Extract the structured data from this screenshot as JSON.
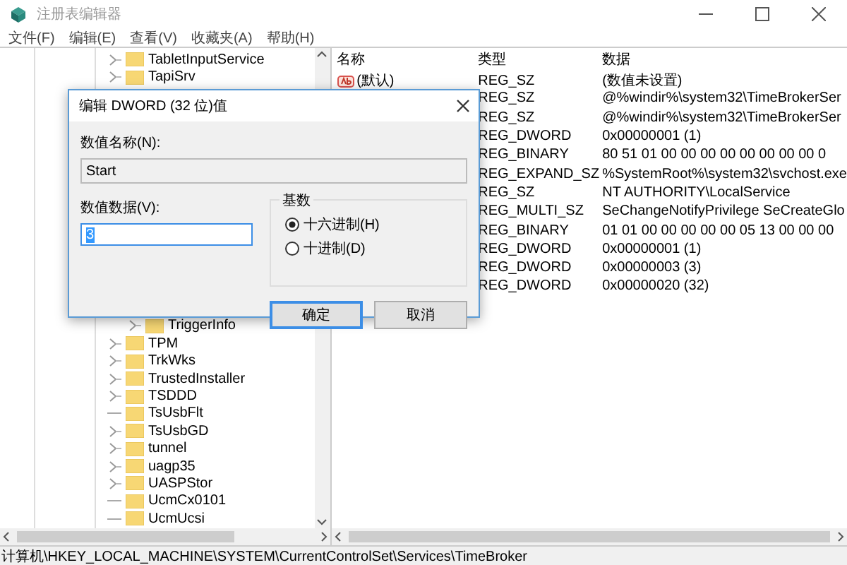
{
  "window": {
    "title": "注册表编辑器"
  },
  "menu": [
    "文件(F)",
    "编辑(E)",
    "查看(V)",
    "收藏夹(A)",
    "帮助(H)"
  ],
  "tree": {
    "items": [
      {
        "label": "TabletInputService",
        "expandable": true
      },
      {
        "label": "TapiSrv",
        "expandable": true
      },
      {
        "children": [
          {
            "label": "TriggerInfo",
            "expandable": true
          }
        ]
      },
      {
        "label": "TPM",
        "expandable": true
      },
      {
        "label": "TrkWks",
        "expandable": true
      },
      {
        "label": "TrustedInstaller",
        "expandable": true
      },
      {
        "label": "TSDDD",
        "expandable": true
      },
      {
        "label": "TsUsbFlt",
        "expandable": false
      },
      {
        "label": "TsUsbGD",
        "expandable": true
      },
      {
        "label": "tunnel",
        "expandable": true
      },
      {
        "label": "uagp35",
        "expandable": true
      },
      {
        "label": "UASPStor",
        "expandable": true
      },
      {
        "label": "UcmCx0101",
        "expandable": false
      },
      {
        "label": "UcmUcsi",
        "expandable": false
      }
    ]
  },
  "values": {
    "columns": [
      "名称",
      "类型",
      "数据"
    ],
    "rows": [
      {
        "name": "(默认)",
        "type": "REG_SZ",
        "data": "(数值未设置)"
      },
      {
        "type": "REG_SZ",
        "data": "@%windir%\\system32\\TimeBrokerSer"
      },
      {
        "type": "REG_SZ",
        "data": "@%windir%\\system32\\TimeBrokerSer"
      },
      {
        "type": "REG_DWORD",
        "data": "0x00000001 (1)"
      },
      {
        "type": "REG_BINARY",
        "data": "80 51 01 00 00 00 00 00 00 00 00 0"
      },
      {
        "type": "REG_EXPAND_SZ",
        "data": "%SystemRoot%\\system32\\svchost.exe"
      },
      {
        "type": "REG_SZ",
        "data": "NT AUTHORITY\\LocalService"
      },
      {
        "type": "REG_MULTI_SZ",
        "data": "SeChangeNotifyPrivilege SeCreateGlo"
      },
      {
        "type": "REG_BINARY",
        "data": "01 01 00 00 00 00 00 05 13 00 00 00"
      },
      {
        "type": "REG_DWORD",
        "data": "0x00000001 (1)"
      },
      {
        "type": "REG_DWORD",
        "data": "0x00000003 (3)"
      },
      {
        "type": "REG_DWORD",
        "data": "0x00000020 (32)"
      }
    ]
  },
  "status_bar": "计算机\\HKEY_LOCAL_MACHINE\\SYSTEM\\CurrentControlSet\\Services\\TimeBroker",
  "dialog": {
    "title": "编辑 DWORD (32 位)值",
    "name_label": "数值名称(N):",
    "name_value": "Start",
    "data_label": "数值数据(V):",
    "data_value": "3",
    "base_group": {
      "label": "基数",
      "options": [
        {
          "label": "十六进制(H)",
          "selected": true
        },
        {
          "label": "十进制(D)",
          "selected": false
        }
      ]
    },
    "buttons": [
      {
        "label": "确定",
        "default": true
      },
      {
        "label": "取消",
        "default": false
      }
    ]
  }
}
